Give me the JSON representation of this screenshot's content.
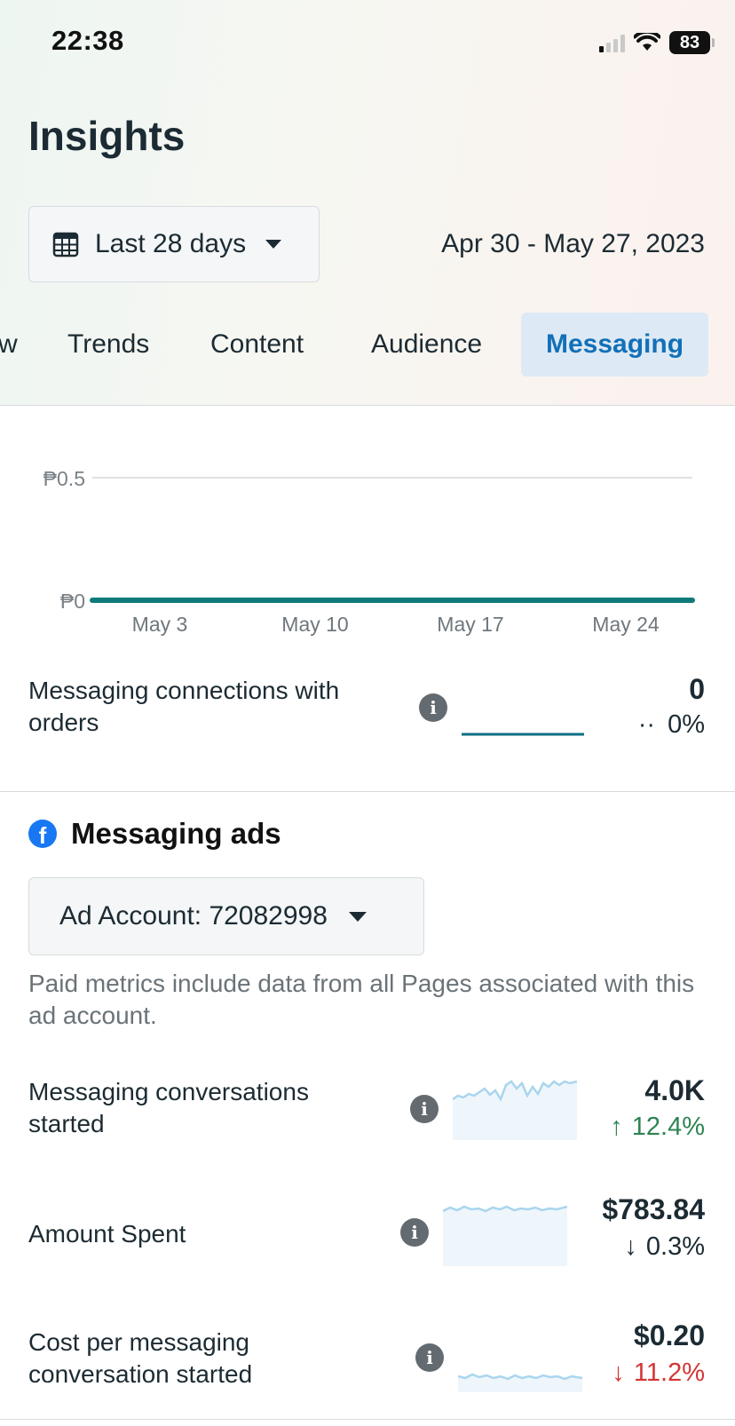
{
  "status_bar": {
    "time": "22:38",
    "battery": "83"
  },
  "header": {
    "title": "Insights",
    "range_button_label": "Last 28 days",
    "date_range": "Apr 30 - May 27, 2023"
  },
  "tabs": [
    {
      "label": "w"
    },
    {
      "label": "Trends"
    },
    {
      "label": "Content"
    },
    {
      "label": "Audience"
    },
    {
      "label": "Messaging",
      "active": true
    }
  ],
  "chart_data": {
    "type": "line",
    "y_ticks": [
      "₱0.5",
      "₱0"
    ],
    "ylim": [
      0,
      0.5
    ],
    "x_ticks": [
      "May 3",
      "May 10",
      "May 17",
      "May 24"
    ],
    "series": [
      {
        "values": [
          0,
          0,
          0,
          0
        ]
      }
    ],
    "line_color": "#0f7a7a"
  },
  "connections": {
    "label": "Messaging connections with orders",
    "value": "0",
    "change_glyph": "··",
    "change": "0%"
  },
  "ads": {
    "section_title": "Messaging ads",
    "account_label": "Ad Account: 72082998",
    "note": "Paid metrics include data from all Pages associated with this ad account.",
    "metrics": [
      {
        "label": "Messaging conversations started",
        "value": "4.0K",
        "arrow": "↑",
        "change": "12.4%"
      },
      {
        "label": "Amount Spent",
        "value": "$783.84",
        "arrow": "↓",
        "change": "0.3%"
      },
      {
        "label": "Cost per messaging conversation started",
        "value": "$0.20",
        "arrow": "↓",
        "change": "11.2%"
      }
    ]
  },
  "colors": {
    "accent_blue": "#1270b7",
    "positive_green": "#2e8452",
    "negative_red": "#d43535",
    "spark_line": "#a9d5ee",
    "spark_fill": "#eef6fc"
  }
}
